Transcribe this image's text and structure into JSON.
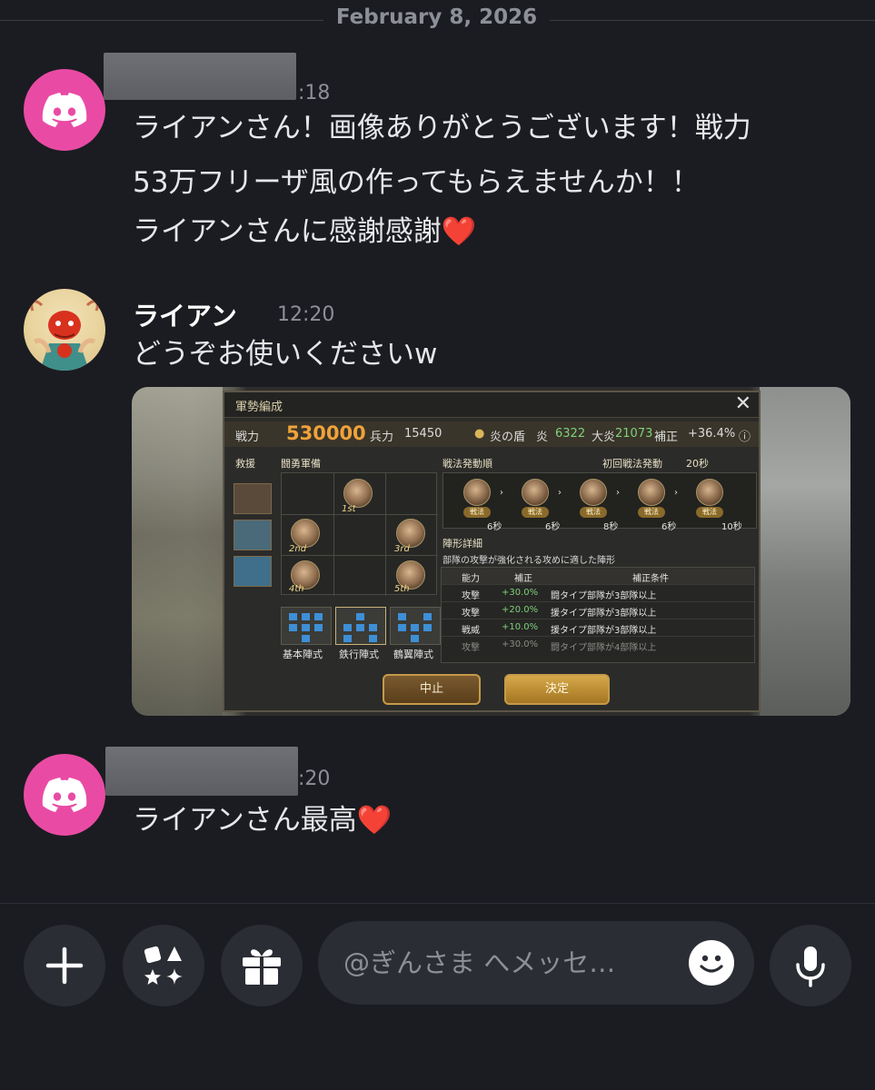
{
  "date_divider": "February 8, 2026",
  "messages": [
    {
      "time": ":18",
      "lines": [
        "ライアンさん！画像ありがとうございます！戦力",
        "53万フリーザ風の作ってもらえませんか！！",
        "ライアンさんに感謝感謝"
      ],
      "emoji": "❤️"
    },
    {
      "author": "ライアン",
      "time": "12:20",
      "text": "どうぞお使いくださいw"
    },
    {
      "time": ":20",
      "text": "ライアンさん最高",
      "emoji": "❤️"
    }
  ],
  "game": {
    "title": "軍勢編成",
    "power_label": "戦力",
    "power": "530000",
    "troops_label": "兵力",
    "troops": "15450",
    "shield_label": "炎の盾",
    "element": "炎",
    "element_value": "6322",
    "big_label": "大炎",
    "big_value": "21073",
    "bonus_label": "補正",
    "bonus": "+36.4%",
    "support_label": "救援",
    "formation_label": "闘勇軍備",
    "tactic_order_label": "戦法発動順",
    "first_tactic_label": "初回戦法発動",
    "first_tactic_time": "20秒",
    "ordinals": [
      "1st",
      "2nd",
      "3rd",
      "4th",
      "5th"
    ],
    "tactic_badge": "戦法",
    "tactic_secs": [
      "6秒",
      "6秒",
      "8秒",
      "6秒",
      "10秒"
    ],
    "formation_detail_label": "陣形詳細",
    "formation_desc": "部隊の攻撃が強化される攻めに適した陣形",
    "formations": [
      "基本陣式",
      "鉄行陣式",
      "鶴翼陣式"
    ],
    "table_headers": [
      "能力",
      "補正",
      "補正条件"
    ],
    "table_rows": [
      {
        "ability": "攻撃",
        "bonus": "+30.0%",
        "cond": "闘タイプ部隊が3部隊以上"
      },
      {
        "ability": "攻撃",
        "bonus": "+20.0%",
        "cond": "援タイプ部隊が3部隊以上"
      },
      {
        "ability": "戦威",
        "bonus": "+10.0%",
        "cond": "援タイプ部隊が3部隊以上"
      },
      {
        "ability": "攻撃",
        "bonus": "+30.0%",
        "cond": "闘タイプ部隊が4部隊以上"
      }
    ],
    "cancel": "中止",
    "confirm": "決定"
  },
  "composer": {
    "placeholder": "@ぎんさま へメッセ…"
  },
  "icons": [
    "plus-icon",
    "apps-icon",
    "gift-icon",
    "emoji-icon",
    "microphone-icon",
    "discord-logo-icon"
  ],
  "colors": {
    "background": "#1b1c21",
    "discord_avatar": "#e94ba4",
    "heart": "#e0192e"
  }
}
